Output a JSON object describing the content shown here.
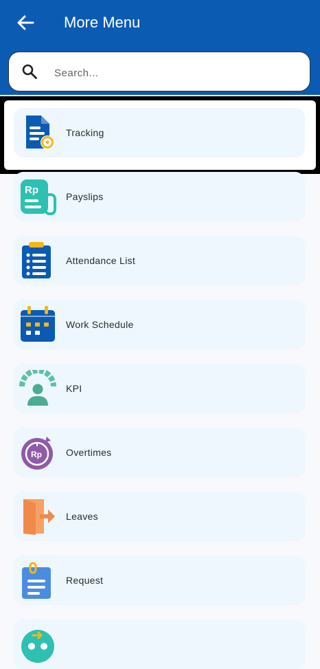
{
  "header": {
    "title": "More Menu",
    "background": "#0b5bb3",
    "back_icon": "arrow-left-icon"
  },
  "search": {
    "placeholder": "Search...",
    "value": "",
    "icon": "search-icon"
  },
  "menu": {
    "items": [
      {
        "label": "Tracking",
        "icon": "tracking-document-icon"
      },
      {
        "label": "Payslips",
        "icon": "payslip-rp-icon"
      },
      {
        "label": "Attendance List",
        "icon": "clipboard-list-icon"
      },
      {
        "label": "Work Schedule",
        "icon": "calendar-icon"
      },
      {
        "label": "KPI",
        "icon": "kpi-gauge-person-icon"
      },
      {
        "label": "Overtimes",
        "icon": "overtime-clock-rp-icon"
      },
      {
        "label": "Leaves",
        "icon": "exit-door-icon"
      },
      {
        "label": "Request",
        "icon": "request-document-icon"
      },
      {
        "label": "",
        "icon": "partial-menu-icon"
      }
    ]
  },
  "colors": {
    "item_bg": "#edf7fd",
    "page_bg": "#f7f9fd",
    "selected_outline": "#000000"
  }
}
